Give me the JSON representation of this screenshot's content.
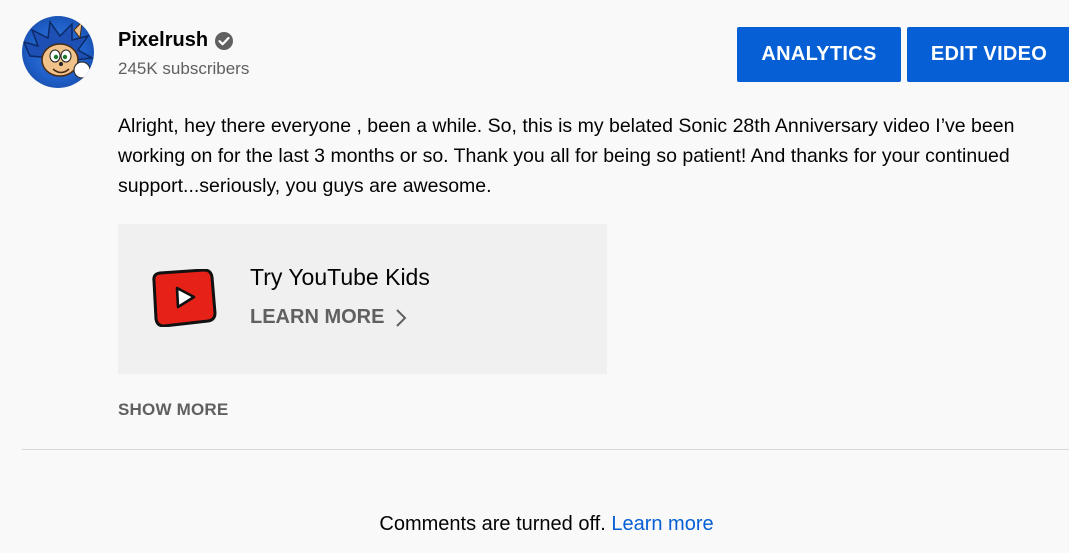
{
  "owner": {
    "channel_name": "Pixelrush",
    "subscribers": "245K subscribers",
    "avatar_icon": "sonic-character-avatar",
    "verified_icon": "verified-checkmark-icon"
  },
  "actions": {
    "analytics_label": "ANALYTICS",
    "edit_label": "EDIT VIDEO"
  },
  "description": {
    "text": "Alright, hey there everyone , been a while. So, this is my belated Sonic 28th Anniversary video I’ve been working on for the last 3 months or so. Thank you all for being so patient! And thanks for your continued support...seriously, you guys are awesome."
  },
  "promo": {
    "title": "Try YouTube Kids",
    "link_label": "LEARN MORE",
    "logo_icon": "youtube-kids-logo-icon",
    "logo_color": "#e62117"
  },
  "show_more_label": "SHOW MORE",
  "comments": {
    "message": "Comments are turned off.",
    "link_label": "Learn more"
  },
  "colors": {
    "accent": "#065fd4",
    "background": "#f9f9f9",
    "secondary_text": "#606060"
  }
}
